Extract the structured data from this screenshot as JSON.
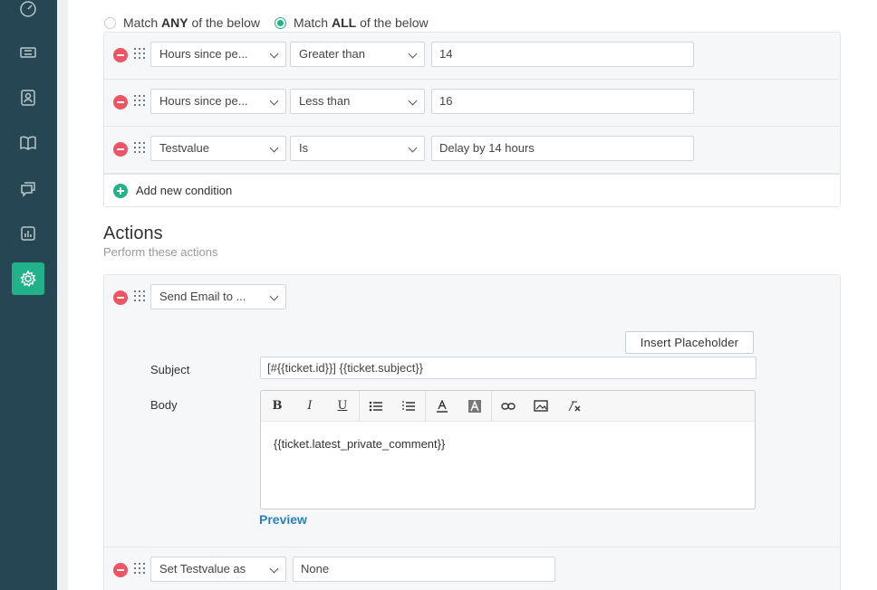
{
  "sidebar": {
    "items": [
      {
        "name": "dashboard",
        "active": false
      },
      {
        "name": "tickets",
        "active": false
      },
      {
        "name": "contacts",
        "active": false
      },
      {
        "name": "knowledge-base",
        "active": false
      },
      {
        "name": "chat",
        "active": false
      },
      {
        "name": "reports",
        "active": false
      },
      {
        "name": "settings",
        "active": true
      }
    ]
  },
  "match": {
    "any_prefix": "Match",
    "any_bold": "ANY",
    "any_suffix": "of the below",
    "all_prefix": "Match",
    "all_bold": "ALL",
    "all_suffix": "of the below",
    "selected": "all"
  },
  "conditions": [
    {
      "field": "Hours since pe...",
      "operator": "Greater than",
      "value": "14"
    },
    {
      "field": "Hours since pe...",
      "operator": "Less than",
      "value": "16"
    },
    {
      "field": "Testvalue",
      "operator": "Is",
      "value": "Delay by 14 hours"
    }
  ],
  "add_condition_label": "Add new condition",
  "actions": {
    "title": "Actions",
    "subtitle": "Perform these actions",
    "email_action": "Send Email to ...",
    "insert_placeholder_label": "Insert Placeholder",
    "subject_label": "Subject",
    "subject_value": "[#{{ticket.id}}] {{ticket.subject}}",
    "body_label": "Body",
    "body_value": "{{ticket.latest_private_comment}}",
    "preview_label": "Preview",
    "set_action": "Set Testvalue as",
    "set_value": "None"
  },
  "toolbar": {
    "bold": "B",
    "italic": "I",
    "underline": "U"
  },
  "colors": {
    "sidebar": "#264653",
    "accent": "#21b28a",
    "remove": "#ed5565",
    "link": "#2a7fc4"
  }
}
